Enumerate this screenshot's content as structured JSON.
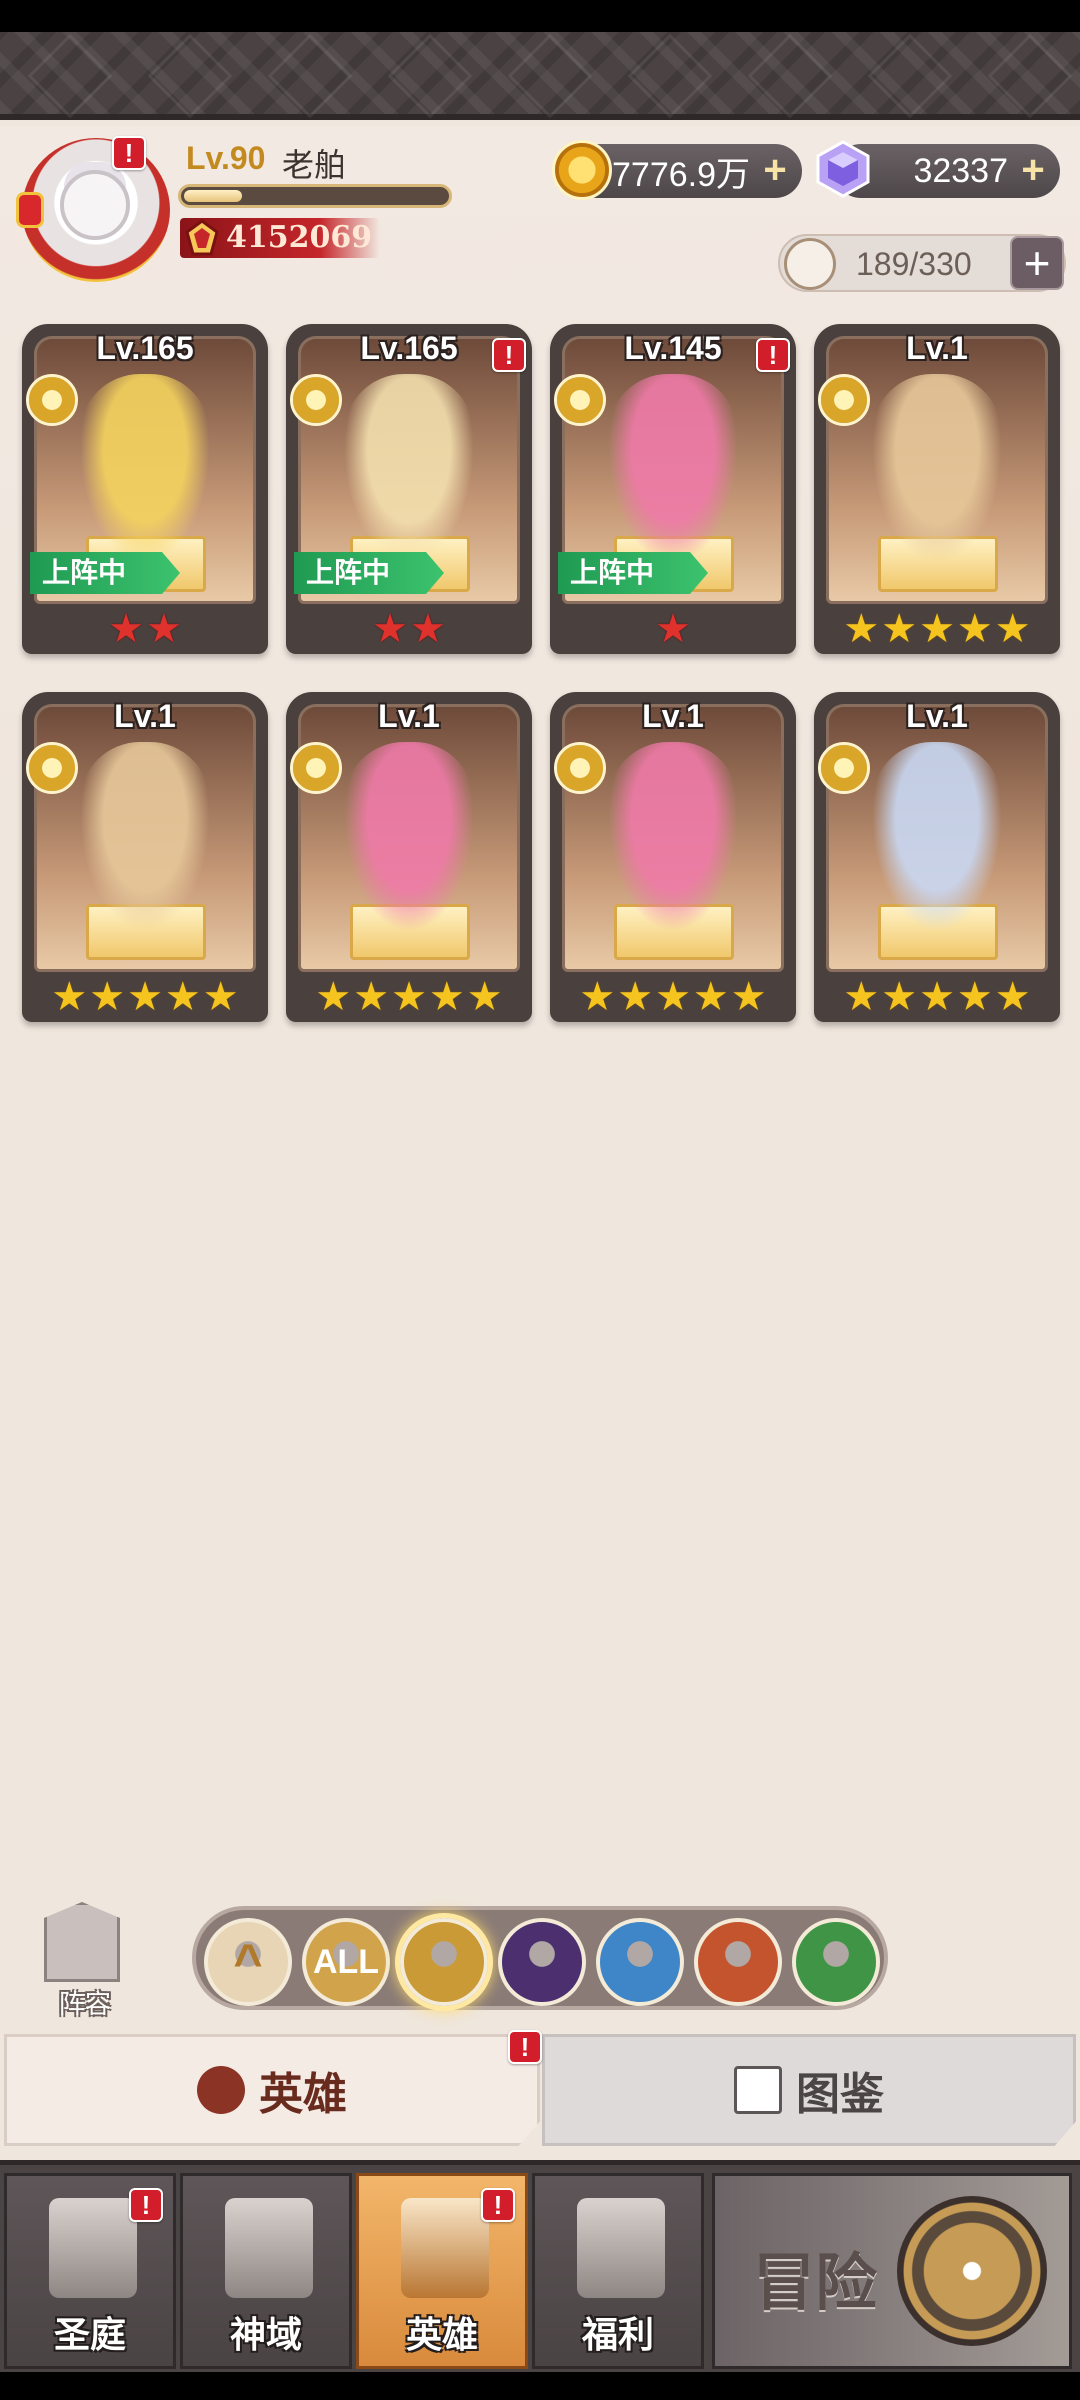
{
  "player": {
    "level": "Lv.90",
    "name": "老舶",
    "power": "4152069",
    "exp_progress": 0.22,
    "avatar_badge": "!"
  },
  "resources": {
    "gold": "7776.9万",
    "diamonds": "32337",
    "hero_slots": "189/330",
    "add": "+"
  },
  "heroes": [
    {
      "level": "Lv.165",
      "stars": 2,
      "star_color": "red",
      "deployed": true,
      "deployed_label": "上阵中",
      "alert": false,
      "figure_color": "#f4d35e"
    },
    {
      "level": "Lv.165",
      "stars": 2,
      "star_color": "red",
      "deployed": true,
      "deployed_label": "上阵中",
      "alert": true,
      "figure_color": "#f3dfae"
    },
    {
      "level": "Lv.145",
      "stars": 1,
      "star_color": "red",
      "deployed": true,
      "deployed_label": "上阵中",
      "alert": true,
      "figure_color": "#ef7aa8"
    },
    {
      "level": "Lv.1",
      "stars": 5,
      "star_color": "gold",
      "deployed": false,
      "deployed_label": "",
      "alert": false,
      "figure_color": "#e7c89a"
    },
    {
      "level": "Lv.1",
      "stars": 5,
      "star_color": "gold",
      "deployed": false,
      "deployed_label": "",
      "alert": false,
      "figure_color": "#e7c89a"
    },
    {
      "level": "Lv.1",
      "stars": 5,
      "star_color": "gold",
      "deployed": false,
      "deployed_label": "",
      "alert": false,
      "figure_color": "#ef7aa8"
    },
    {
      "level": "Lv.1",
      "stars": 5,
      "star_color": "gold",
      "deployed": false,
      "deployed_label": "",
      "alert": false,
      "figure_color": "#ef7aa8"
    },
    {
      "level": "Lv.1",
      "stars": 5,
      "star_color": "gold",
      "deployed": false,
      "deployed_label": "",
      "alert": false,
      "figure_color": "#c9d8f3"
    }
  ],
  "lineup": {
    "label": "阵容"
  },
  "filters": [
    {
      "icon": "chevron-up-icon",
      "label": "",
      "color": "#e8d5b5"
    },
    {
      "icon": "all-icon",
      "label": "ALL",
      "color": "#d1a34a"
    },
    {
      "icon": "holy-faction-icon",
      "label": "",
      "color": "#c99a35"
    },
    {
      "icon": "dark-faction-icon",
      "label": "",
      "color": "#4b2f6e"
    },
    {
      "icon": "water-faction-icon",
      "label": "",
      "color": "#3f86c8"
    },
    {
      "icon": "fire-faction-icon",
      "label": "",
      "color": "#c4542e"
    },
    {
      "icon": "nature-faction-icon",
      "label": "",
      "color": "#3f9446"
    }
  ],
  "tabs": {
    "heroes": "英雄",
    "codex": "图鉴",
    "badge": "!"
  },
  "nav": {
    "items": [
      {
        "label": "圣庭",
        "alert": true
      },
      {
        "label": "神域",
        "alert": false
      },
      {
        "label": "英雄",
        "alert": true
      },
      {
        "label": "福利",
        "alert": false
      }
    ],
    "adventure": "冒险",
    "badge": "!"
  }
}
